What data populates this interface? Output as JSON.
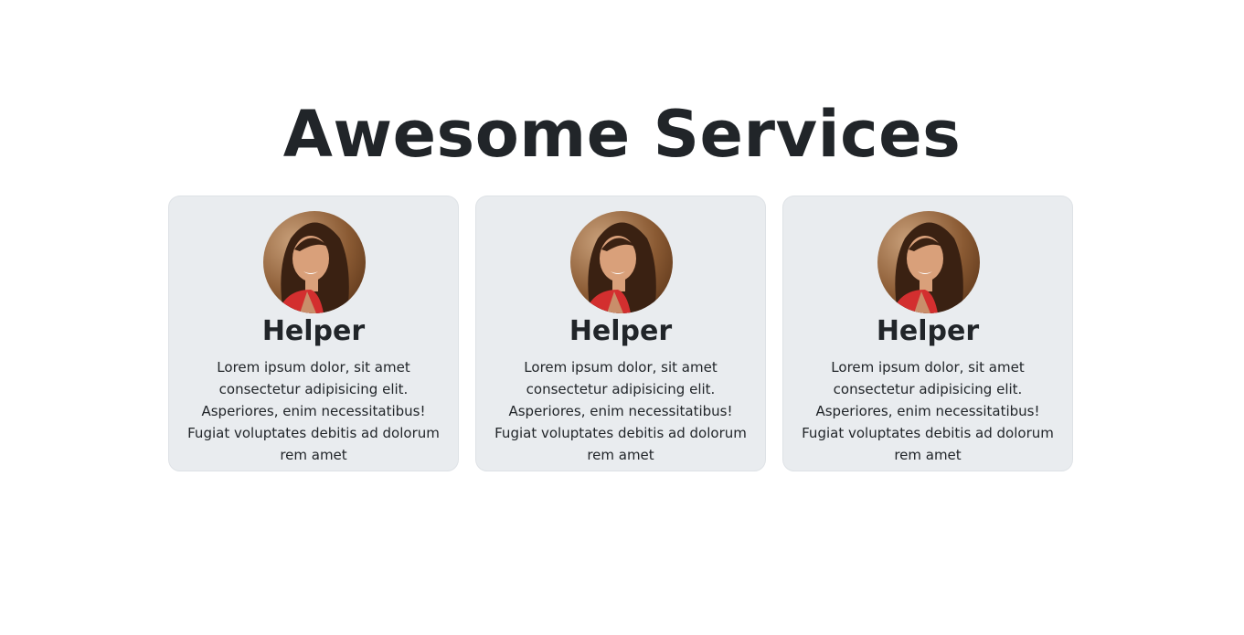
{
  "header": {
    "title": "Awesome Services"
  },
  "cards": [
    {
      "title": "Helper",
      "text": "Lorem ipsum dolor, sit amet consectetur adipisicing elit. Asperiores, enim necessitatibus! Fugiat voluptates debitis ad dolorum rem amet",
      "image": "portrait-photo"
    },
    {
      "title": "Helper",
      "text": "Lorem ipsum dolor, sit amet consectetur adipisicing elit. Asperiores, enim necessitatibus! Fugiat voluptates debitis ad dolorum rem amet",
      "image": "portrait-photo"
    },
    {
      "title": "Helper",
      "text": "Lorem ipsum dolor, sit amet consectetur adipisicing elit. Asperiores, enim necessitatibus! Fugiat voluptates debitis ad dolorum rem amet",
      "image": "portrait-photo"
    }
  ],
  "colors": {
    "card_background": "#e9ecef",
    "card_border": "#dee2e6",
    "text": "#212529"
  }
}
